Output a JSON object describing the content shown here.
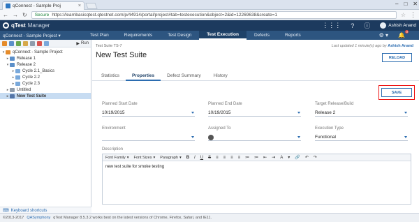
{
  "browser": {
    "tab_title": "qConnect - Sample Proj",
    "tab_close": "×",
    "secure_label": "Secure",
    "url": "https://learnbasicqtest.qtestnet.com/p/44914/portal/project#tab=testexecution&object=2&id=12269638&create=1",
    "back": "←",
    "forward": "→",
    "refresh": "↻",
    "star": "☆",
    "menu": "⋮",
    "win_min": "–",
    "win_max": "□",
    "win_close": "✕"
  },
  "app": {
    "logo": "qTest",
    "product": "Manager",
    "user_name": "Ashish Anand",
    "apps_icon": "⋮⋮⋮",
    "help_icon": "?",
    "info_icon": "ⓘ"
  },
  "project_nav": {
    "project": "qConnect - Sample Project ▾",
    "links": [
      "Test Plan",
      "Requirements",
      "Test Design",
      "Test Execution",
      "Defects",
      "Reports"
    ],
    "settings_icon": "⚙ ▾",
    "bell_icon": "🔔",
    "notif_count": "0"
  },
  "sidebar": {
    "run_label": "Run",
    "tree": [
      {
        "label": "qConnect - Sample Project",
        "twisty": "▾",
        "icon": "project"
      },
      {
        "label": "Release 1",
        "twisty": "▸",
        "icon": "release"
      },
      {
        "label": "Release 2",
        "twisty": "▾",
        "icon": "release"
      },
      {
        "label": "Cycle 2.1_Basics",
        "twisty": "▸",
        "icon": "cycle"
      },
      {
        "label": "Cycle 2.2",
        "twisty": "▸",
        "icon": "cycle"
      },
      {
        "label": "Cycle 2.3",
        "twisty": "▸",
        "icon": "cycle"
      },
      {
        "label": "Untitled",
        "twisty": "▸",
        "icon": "untitled"
      },
      {
        "label": "New Test Suite",
        "twisty": "▸",
        "icon": "suite"
      }
    ],
    "keyboard_shortcuts": "Keyboard shortcuts"
  },
  "main": {
    "breadcrumb": "Test Suite TS-7",
    "last_updated": "Last updated 1 minute(s) ago by",
    "last_updated_by": "Ashish Anand",
    "title": "New Test Suite",
    "reload_label": "RELOAD",
    "tabs": [
      "Statistics",
      "Properties",
      "Defect Summary",
      "History"
    ],
    "active_tab": "Properties",
    "save_label": "SAVE",
    "fields": {
      "planned_start_label": "Planned Start Date",
      "planned_start_value": "10/19/2015",
      "planned_end_label": "Planned End Date",
      "planned_end_value": "10/19/2015",
      "target_release_label": "Target Release/Build",
      "target_release_value": "Release 2",
      "environment_label": "Environment",
      "environment_value": "",
      "assigned_to_label": "Assigned To",
      "assigned_to_value": "",
      "execution_type_label": "Execution Type",
      "execution_type_value": "Functional"
    },
    "description_label": "Description",
    "editor": {
      "font_family": "Font Family",
      "font_sizes": "Font Sizes",
      "paragraph": "Paragraph",
      "buttons": [
        "B",
        "I",
        "U",
        "S",
        "≡",
        "≡",
        "≡",
        "≡",
        "≔",
        "≔",
        "⇤",
        "⇥",
        "A",
        "▾",
        "🔗",
        "↶",
        "↷"
      ],
      "content": "new test suite for smoke testing"
    }
  },
  "footer": {
    "copyright": "©2013-2017",
    "company": "QASymphony",
    "version_text": "qTest Manager 8.5.3.2 works best on the latest versions of Chrome, Firefox, Safari, and IE11."
  },
  "colors": {
    "app_header": "#1c3a5e",
    "project_nav": "#2d5580",
    "accent": "#2b6cb0",
    "highlight": "#e11111"
  }
}
